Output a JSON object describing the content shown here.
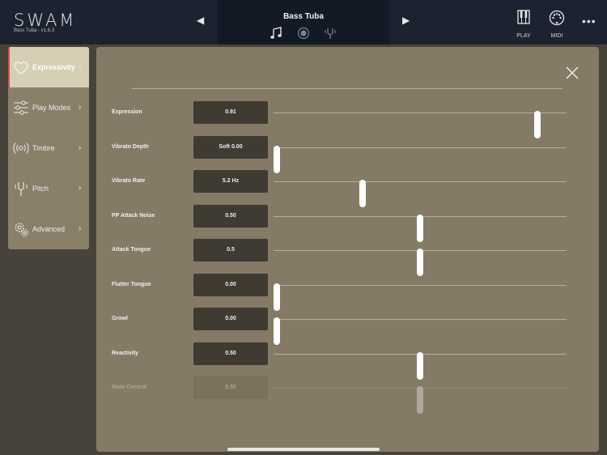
{
  "app": {
    "logo": "SWAM",
    "version": "Bass Tuba - v1.6.3"
  },
  "header": {
    "preset_name": "Bass Tuba",
    "prev_icon": "triangle-left-icon",
    "next_icon": "triangle-right-icon",
    "play_label": "PLAY",
    "midi_label": "MIDI",
    "more_icon": "ellipsis-icon",
    "more_glyph": "•••",
    "prev_glyph": "◀",
    "next_glyph": "▶"
  },
  "sidebar": {
    "items": [
      {
        "label": "Expressivity",
        "icon": "heart-icon",
        "active": true
      },
      {
        "label": "Play Modes",
        "icon": "sliders-icon",
        "active": false
      },
      {
        "label": "Timbre",
        "icon": "radio-waves-icon",
        "active": false
      },
      {
        "label": "Pitch",
        "icon": "tuning-fork-icon",
        "active": false
      },
      {
        "label": "Advanced",
        "icon": "gear-icon",
        "active": false
      }
    ],
    "chevron": "›"
  },
  "params": [
    {
      "label": "Expression",
      "value": "0.91",
      "level": 0.91,
      "disabled": false
    },
    {
      "label": "Vibrato Depth",
      "value": "Soft 0.00",
      "level": 0.0,
      "disabled": false
    },
    {
      "label": "Vibrato Rate",
      "value": "5.2 Hz",
      "level": 0.3,
      "disabled": false
    },
    {
      "label": "PP Attack Noise",
      "value": "0.50",
      "level": 0.5,
      "disabled": false
    },
    {
      "label": "Attack Tongue",
      "value": "0.5",
      "level": 0.5,
      "disabled": false
    },
    {
      "label": "Flutter Tongue",
      "value": "0.00",
      "level": 0.0,
      "disabled": false
    },
    {
      "label": "Growl",
      "value": "0.00",
      "level": 0.0,
      "disabled": false
    },
    {
      "label": "Reactivity",
      "value": "0.50",
      "level": 0.5,
      "disabled": false
    },
    {
      "label": "Mute Control",
      "value": "0.50",
      "level": 0.5,
      "disabled": true
    }
  ],
  "colors": {
    "accent": "#e24a4a",
    "panel": "#857a65",
    "topbar": "#1c2330"
  }
}
